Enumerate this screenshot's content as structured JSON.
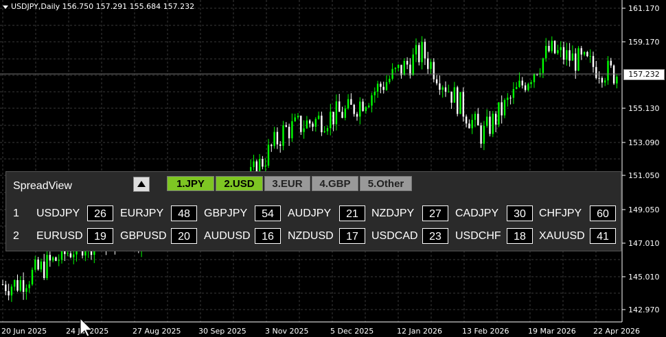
{
  "chart": {
    "symbol_line": "USDJPY,Daily  156.750 157.291 155.684 157.232",
    "current_price": "157.232",
    "price_labels": [
      "161.170",
      "159.170",
      "155.130",
      "153.090",
      "151.050",
      "149.050",
      "147.010",
      "145.010",
      "142.970"
    ],
    "date_labels": [
      "20 Jun 2025",
      "24 Jul 2025",
      "27 Aug 2025",
      "30 Sep 2025",
      "3 Nov 2025",
      "5 Dec 2025",
      "12 Jan 2026",
      "13 Feb 2026",
      "19 Mar 2026",
      "22 Apr 2026"
    ],
    "colors": {
      "bullish": "#00ff00",
      "bearish": "#ffffff",
      "grid": "#3a3a3a"
    }
  },
  "chart_data": {
    "type": "candlestick",
    "title": "USDJPY,Daily",
    "ylim": [
      142.0,
      162.0
    ],
    "x": [
      "20 Jun 2025",
      "24 Jul 2025",
      "27 Aug 2025",
      "30 Sep 2025",
      "3 Nov 2025",
      "5 Dec 2025",
      "12 Jan 2026",
      "13 Feb 2026",
      "19 Mar 2026",
      "22 Apr 2026"
    ],
    "close_approx": [
      144.5,
      147.0,
      147.5,
      148.5,
      153.8,
      155.0,
      158.5,
      153.5,
      158.6,
      157.2
    ],
    "last_bar": {
      "open": 156.75,
      "high": 157.291,
      "low": 155.684,
      "close": 157.232
    }
  },
  "panel": {
    "title": "SpreadView",
    "tabs": [
      {
        "label": "1.JPY",
        "active": true
      },
      {
        "label": "2.USD",
        "active": true
      },
      {
        "label": "3.EUR",
        "active": false
      },
      {
        "label": "4.GBP",
        "active": false
      },
      {
        "label": "5.Other",
        "active": false
      }
    ],
    "rows": [
      {
        "num": "1",
        "items": [
          {
            "sym": "USDJPY",
            "val": "26"
          },
          {
            "sym": "EURJPY",
            "val": "48"
          },
          {
            "sym": "GBPJPY",
            "val": "54"
          },
          {
            "sym": "AUDJPY",
            "val": "21"
          },
          {
            "sym": "NZDJPY",
            "val": "27"
          },
          {
            "sym": "CADJPY",
            "val": "30"
          },
          {
            "sym": "CHFJPY",
            "val": "60"
          }
        ]
      },
      {
        "num": "2",
        "items": [
          {
            "sym": "EURUSD",
            "val": "19"
          },
          {
            "sym": "GBPUSD",
            "val": "20"
          },
          {
            "sym": "AUDUSD",
            "val": "16"
          },
          {
            "sym": "NZDUSD",
            "val": "17"
          },
          {
            "sym": "USDCAD",
            "val": "23"
          },
          {
            "sym": "USDCHF",
            "val": "18"
          },
          {
            "sym": "XAUUSD",
            "val": "41"
          }
        ]
      }
    ]
  }
}
